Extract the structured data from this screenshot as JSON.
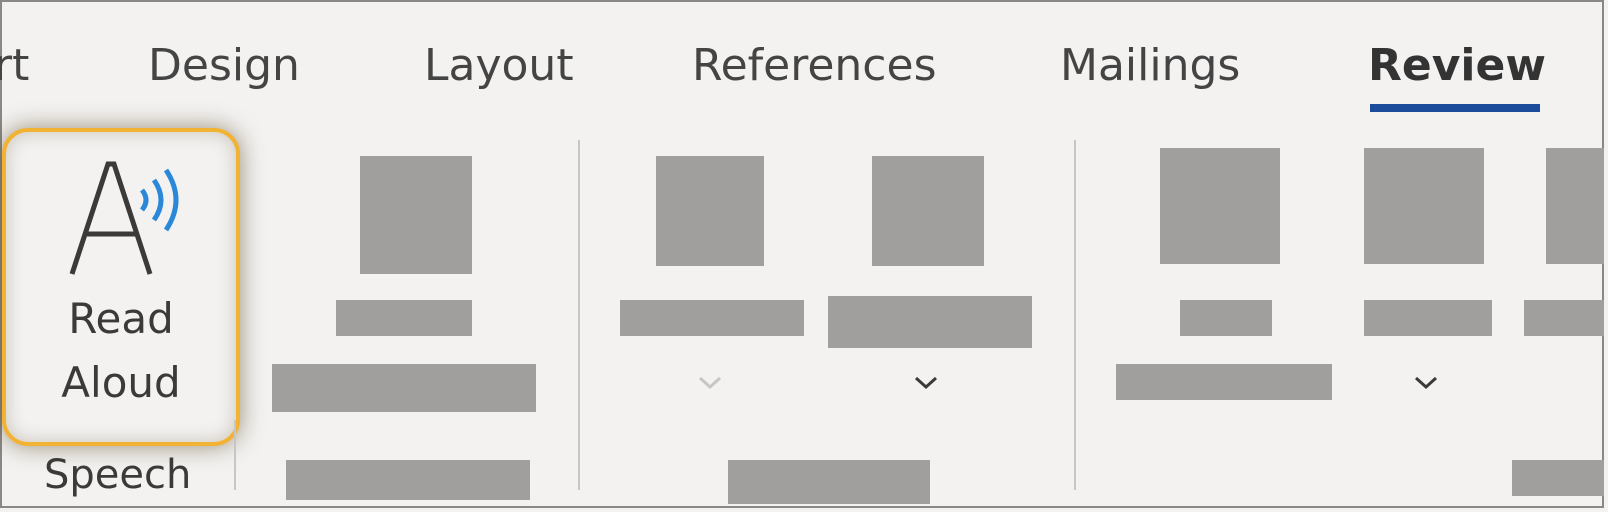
{
  "ribbon": {
    "tabs": [
      {
        "label": "rt"
      },
      {
        "label": "Design"
      },
      {
        "label": "Layout"
      },
      {
        "label": "References"
      },
      {
        "label": "Mailings"
      },
      {
        "label": "Review",
        "active": true
      }
    ],
    "speech_group": {
      "button_label_line1": "Read",
      "button_label_line2": "Aloud",
      "group_label": "Speech",
      "icon": "read-aloud-icon"
    },
    "colors": {
      "accent": "#1b4b9b",
      "highlight": "#f2b233",
      "sound_waves": "#2b88d8",
      "placeholder": "#a19f9d"
    }
  }
}
